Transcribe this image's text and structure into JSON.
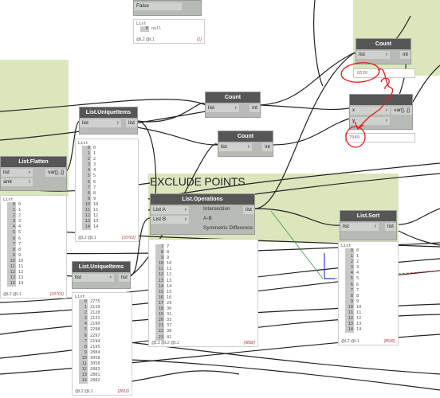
{
  "colors": {
    "group_bg": "#dbe6bd",
    "node_header": "#565656",
    "node_body": "#b8bab6",
    "wire": "#222222",
    "annotation": "#e02020"
  },
  "group": {
    "title": "EXCLUDE POINTS"
  },
  "top_node": {
    "port": "False",
    "preview_header": "List",
    "preview_row": "null",
    "foot_left": "@L2 @L1",
    "foot_count": "{1}"
  },
  "count_top": {
    "title": "Count",
    "in": "list",
    "out": "int",
    "value": "8530"
  },
  "count_mid": {
    "title": "Count",
    "in": "list",
    "out": "int"
  },
  "count_low": {
    "title": "Count",
    "in": "list",
    "out": "int"
  },
  "minus_node": {
    "in_x": "x",
    "in_y": "y",
    "out": "var[]..[]",
    "value": "7989"
  },
  "flatten": {
    "title": "List.Flatten",
    "in1": "list",
    "in2": "amt",
    "out": "var[]..[]",
    "preview_header": "List",
    "rows": [
      "0",
      "1",
      "2",
      "3",
      "4",
      "5",
      "6",
      "7",
      "8",
      "9",
      "10",
      "11",
      "12",
      "13",
      "14"
    ],
    "foot_left": "@L2 @L1",
    "foot_count": "{10701}"
  },
  "unique_top": {
    "title": "List.UniqueItems",
    "in": "list",
    "out": "list",
    "preview_header": "List",
    "rows": [
      "0",
      "1",
      "2",
      "3",
      "4",
      "5",
      "6",
      "7",
      "8",
      "9",
      "10",
      "11",
      "12",
      "13",
      "14"
    ],
    "foot_left": "@L2 @L1",
    "foot_count": "{10701}"
  },
  "unique_bot": {
    "title": "List.UniqueItems",
    "in": "list",
    "out": "list",
    "preview_header": "List",
    "rows": [
      [
        "0",
        "2775"
      ],
      [
        "1",
        "2119"
      ],
      [
        "2",
        "2120"
      ],
      [
        "3",
        "2131"
      ],
      [
        "4",
        "2190"
      ],
      [
        "5",
        "2298"
      ],
      [
        "6",
        "2297"
      ],
      [
        "7",
        "2194"
      ],
      [
        "8",
        "2195"
      ],
      [
        "9",
        "2884"
      ],
      [
        "10",
        "3058"
      ],
      [
        "11",
        "3056"
      ],
      [
        "12",
        "2883"
      ],
      [
        "13",
        "2881"
      ],
      [
        "14",
        "2882"
      ]
    ],
    "foot_left": "@L2 @L1",
    "foot_count": "{2812}"
  },
  "operations": {
    "title": "List.Operations",
    "in_a": "List A",
    "in_b": "List B",
    "out": "list",
    "options": [
      "Intersection",
      "A-B",
      "Symmetric Difference"
    ],
    "rows": [
      [
        "7",
        "7"
      ],
      [
        "8",
        "8"
      ],
      [
        "9",
        "9"
      ],
      [
        "10",
        "10"
      ],
      [
        "11",
        "11"
      ],
      [
        "12",
        "12"
      ],
      [
        "13",
        "13"
      ],
      [
        "14",
        "14"
      ],
      [
        "15",
        "15"
      ],
      [
        "16",
        "16"
      ],
      [
        "17",
        "29"
      ],
      [
        "18",
        "30"
      ],
      [
        "19",
        "31"
      ],
      [
        "20",
        "33"
      ],
      [
        "21",
        "37"
      ],
      [
        "22",
        "38"
      ],
      [
        "23",
        "41"
      ]
    ],
    "foot_left": "@L3 @L2 @L1",
    "foot_count": "{9892}"
  },
  "sort": {
    "title": "List.Sort",
    "in": "list",
    "out": "list",
    "preview_header": "List",
    "rows": [
      "0",
      "1",
      "2",
      "3",
      "4",
      "5",
      "6",
      "7",
      "8",
      "9",
      "10",
      "11",
      "12",
      "13",
      "14"
    ],
    "foot_left": "@L2 @L1",
    "foot_count": "{8530}"
  }
}
